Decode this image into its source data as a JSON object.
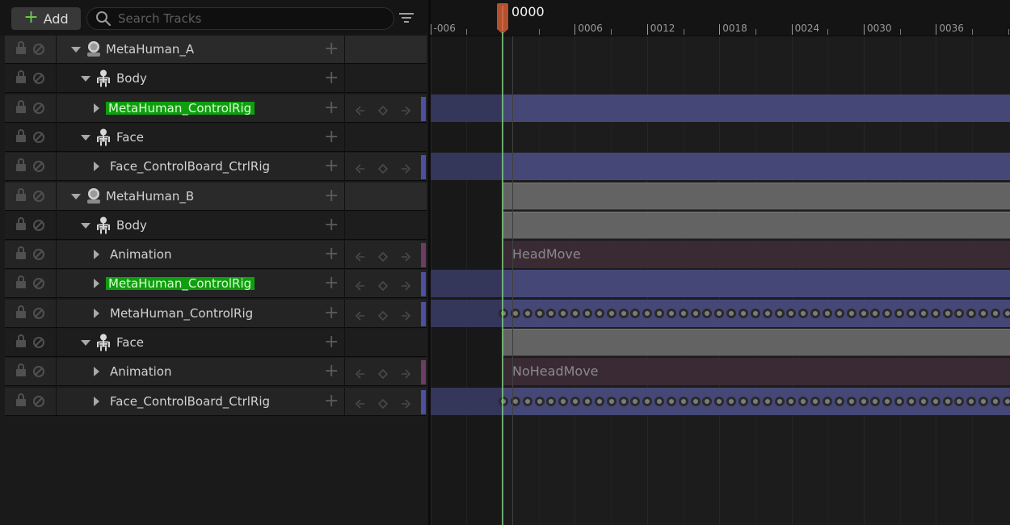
{
  "toolbar": {
    "add_label": "Add",
    "search_placeholder": "Search Tracks"
  },
  "tracks": [
    {
      "type": "object",
      "label": "MetaHuman_A",
      "icon": "metahuman-icon",
      "highlight": false
    },
    {
      "type": "component",
      "label": "Body",
      "icon": "skeleton-icon",
      "highlight": false
    },
    {
      "type": "track",
      "label": "MetaHuman_ControlRig",
      "highlight": true,
      "color": "#4d50a0"
    },
    {
      "type": "component",
      "label": "Face",
      "icon": "skeleton-icon",
      "highlight": false
    },
    {
      "type": "track",
      "label": "Face_ControlBoard_CtrlRig",
      "highlight": false,
      "color": "#4d50a0"
    },
    {
      "type": "object",
      "label": "MetaHuman_B",
      "icon": "metahuman-icon",
      "highlight": false
    },
    {
      "type": "component",
      "label": "Body",
      "icon": "skeleton-icon",
      "highlight": false
    },
    {
      "type": "track",
      "label": "Animation",
      "highlight": false,
      "color": "#6b3d63"
    },
    {
      "type": "track",
      "label": "MetaHuman_ControlRig",
      "highlight": true,
      "color": "#4d50a0"
    },
    {
      "type": "track",
      "label": "MetaHuman_ControlRig",
      "highlight": false,
      "color": "#4d50a0"
    },
    {
      "type": "component",
      "label": "Face",
      "icon": "skeleton-icon",
      "highlight": false
    },
    {
      "type": "track",
      "label": "Animation",
      "highlight": false,
      "color": "#6b3d63"
    },
    {
      "type": "track",
      "label": "Face_ControlBoard_CtrlRig",
      "highlight": false,
      "color": "#4d50a0"
    }
  ],
  "timeline": {
    "current_frame": "0000",
    "ticks": [
      "-006",
      "0006",
      "0012",
      "0018",
      "0024",
      "0030",
      "0036"
    ],
    "sections": {
      "head_move": "HeadMove",
      "no_head_move": "NoHeadMove"
    },
    "accent_color": "#b5502e"
  }
}
